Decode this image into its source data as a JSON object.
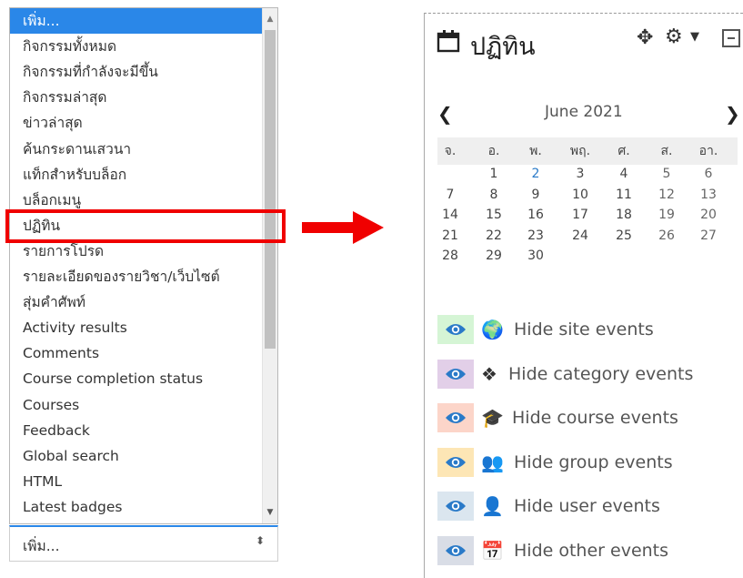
{
  "dropdown": {
    "items": [
      "เพิ่ม...",
      "กิจกรรมทั้งหมด",
      "กิจกรรมที่กำลังจะมีขึ้น",
      "กิจกรรมล่าสุด",
      "ข่าวล่าสุด",
      "ค้นกระดานเสวนา",
      "แท็กสำหรับบล็อก",
      "บล็อกเมนู",
      "ปฏิทิน",
      "รายการโปรด",
      "รายละเอียดของรายวิชา/เว็บไซต์",
      "สุ่มคำศัพท์",
      "Activity results",
      "Comments",
      "Course completion status",
      "Courses",
      "Feedback",
      "Global search",
      "HTML",
      "Latest badges"
    ],
    "selected_index": 0,
    "highlighted_index": 8,
    "select_value": "เพิ่ม...",
    "select_arrows": "⬍",
    "selected_color": "#2a87e8"
  },
  "calendar": {
    "title": "ปฏิทิน",
    "icons": {
      "calendar": "calendar-icon",
      "move": "✥",
      "gear": "⚙",
      "caret": "▼",
      "collapse": "collapse-icon"
    },
    "prev": "❮",
    "next": "❯",
    "month": "June 2021",
    "weekdays": [
      "จ.",
      "อ.",
      "พ.",
      "พฤ.",
      "ศ.",
      "ส.",
      "อา."
    ],
    "weeks": [
      [
        "",
        "1",
        "2",
        "3",
        "4",
        "5",
        "6"
      ],
      [
        "7",
        "8",
        "9",
        "10",
        "11",
        "12",
        "13"
      ],
      [
        "14",
        "15",
        "16",
        "17",
        "18",
        "19",
        "20"
      ],
      [
        "21",
        "22",
        "23",
        "24",
        "25",
        "26",
        "27"
      ],
      [
        "28",
        "29",
        "30",
        "",
        "",
        "",
        ""
      ]
    ],
    "linked_days": [
      "2"
    ],
    "filters": [
      {
        "label": "Hide site events",
        "icon": "globe-icon",
        "glyph": "🌍",
        "color": "#d5f5d5"
      },
      {
        "label": "Hide category events",
        "icon": "cubes-icon",
        "glyph": "❖",
        "color": "#e2cfe8"
      },
      {
        "label": "Hide course events",
        "icon": "graduation-cap-icon",
        "glyph": "🎓",
        "color": "#fcd5c9"
      },
      {
        "label": "Hide group events",
        "icon": "users-icon",
        "glyph": "👥",
        "color": "#fde6b5"
      },
      {
        "label": "Hide user events",
        "icon": "user-icon",
        "glyph": "👤",
        "color": "#dbe6ef"
      },
      {
        "label": "Hide other events",
        "icon": "calendar-grid-icon",
        "glyph": "📅",
        "color": "#d9dde6"
      }
    ]
  },
  "colors": {
    "highlight": "#f00000",
    "arrow": "#f00000",
    "eye": "#2a7ac8"
  }
}
